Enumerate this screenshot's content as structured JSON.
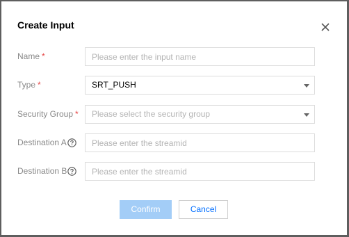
{
  "dialog": {
    "title": "Create Input",
    "close_icon": "close-icon"
  },
  "form": {
    "name": {
      "label": "Name",
      "required": "*",
      "placeholder": "Please enter the input name",
      "value": ""
    },
    "type": {
      "label": "Type",
      "required": "*",
      "selected": "SRT_PUSH"
    },
    "security_group": {
      "label": "Security Group",
      "required": "*",
      "placeholder": "Please select the security group"
    },
    "destination_a": {
      "label": "Destination A",
      "help_icon": "question-circle-icon",
      "placeholder": "Please enter the streamid",
      "value": ""
    },
    "destination_b": {
      "label": "Destination B",
      "help_icon": "question-circle-icon",
      "placeholder": "Please enter the streamid",
      "value": ""
    }
  },
  "footer": {
    "confirm_label": "Confirm",
    "cancel_label": "Cancel"
  },
  "colors": {
    "required": "#e54545",
    "confirm_disabled_bg": "#a3cdf7",
    "link_blue": "#006eff"
  }
}
